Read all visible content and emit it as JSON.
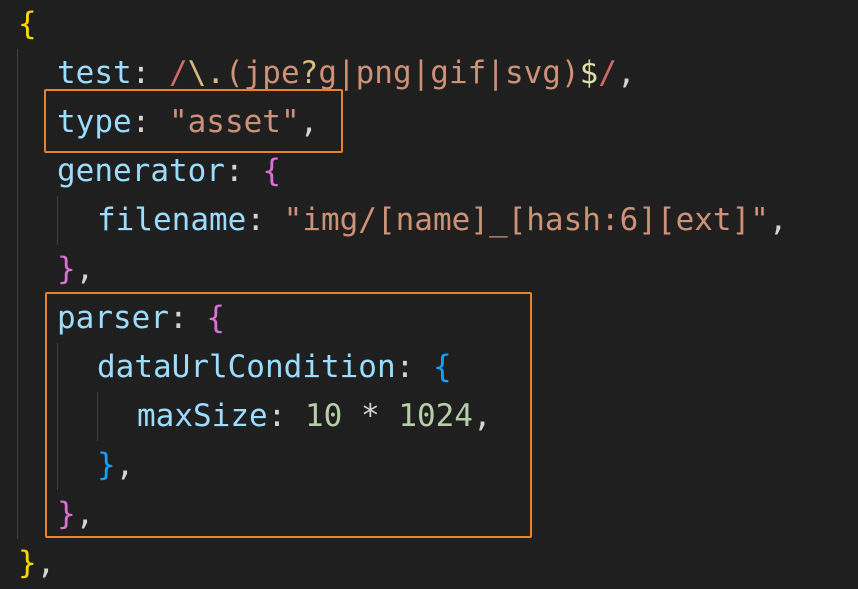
{
  "editor": {
    "lines": [
      {
        "tokens": [
          {
            "t": "{",
            "c": "brace-y"
          }
        ]
      },
      {
        "tokens": [
          {
            "t": "test",
            "c": "prop"
          },
          {
            "t": ": ",
            "c": "punc"
          },
          {
            "t": "/",
            "c": "re-slash"
          },
          {
            "t": "\\.",
            "c": "re-esc"
          },
          {
            "t": "(jpe",
            "c": "re-grp"
          },
          {
            "t": "?",
            "c": "re-q"
          },
          {
            "t": "g|png|gif|svg)",
            "c": "re-grp"
          },
          {
            "t": "$",
            "c": "re-end"
          },
          {
            "t": "/",
            "c": "re-slash"
          },
          {
            "t": ",",
            "c": "punc"
          }
        ]
      },
      {
        "tokens": [
          {
            "t": "type",
            "c": "prop"
          },
          {
            "t": ": ",
            "c": "punc"
          },
          {
            "t": "\"asset\"",
            "c": "str"
          },
          {
            "t": ",",
            "c": "punc"
          }
        ]
      },
      {
        "tokens": [
          {
            "t": "generator",
            "c": "prop"
          },
          {
            "t": ": ",
            "c": "punc"
          },
          {
            "t": "{",
            "c": "brace-p"
          }
        ]
      },
      {
        "tokens": [
          {
            "t": "filename",
            "c": "prop"
          },
          {
            "t": ": ",
            "c": "punc"
          },
          {
            "t": "\"img/[name]_[hash:6][ext]\"",
            "c": "str"
          },
          {
            "t": ",",
            "c": "punc"
          }
        ]
      },
      {
        "tokens": [
          {
            "t": "}",
            "c": "brace-p"
          },
          {
            "t": ",",
            "c": "punc"
          }
        ]
      },
      {
        "tokens": [
          {
            "t": "parser",
            "c": "prop"
          },
          {
            "t": ": ",
            "c": "punc"
          },
          {
            "t": "{",
            "c": "brace-p"
          }
        ]
      },
      {
        "tokens": [
          {
            "t": "dataUrlCondition",
            "c": "prop"
          },
          {
            "t": ": ",
            "c": "punc"
          },
          {
            "t": "{",
            "c": "brace-b"
          }
        ]
      },
      {
        "tokens": [
          {
            "t": "maxSize",
            "c": "prop"
          },
          {
            "t": ": ",
            "c": "punc"
          },
          {
            "t": "10",
            "c": "num"
          },
          {
            "t": " * ",
            "c": "op"
          },
          {
            "t": "1024",
            "c": "num"
          },
          {
            "t": ",",
            "c": "punc"
          }
        ]
      },
      {
        "tokens": [
          {
            "t": "}",
            "c": "brace-b"
          },
          {
            "t": ",",
            "c": "punc"
          }
        ]
      },
      {
        "tokens": [
          {
            "t": "}",
            "c": "brace-p"
          },
          {
            "t": ",",
            "c": "punc"
          }
        ]
      },
      {
        "tokens": [
          {
            "t": "}",
            "c": "brace-y"
          },
          {
            "t": ",",
            "c": "punc"
          }
        ]
      }
    ]
  },
  "colors": {
    "background": "#1f1f1f",
    "highlight": "#e8832a"
  }
}
